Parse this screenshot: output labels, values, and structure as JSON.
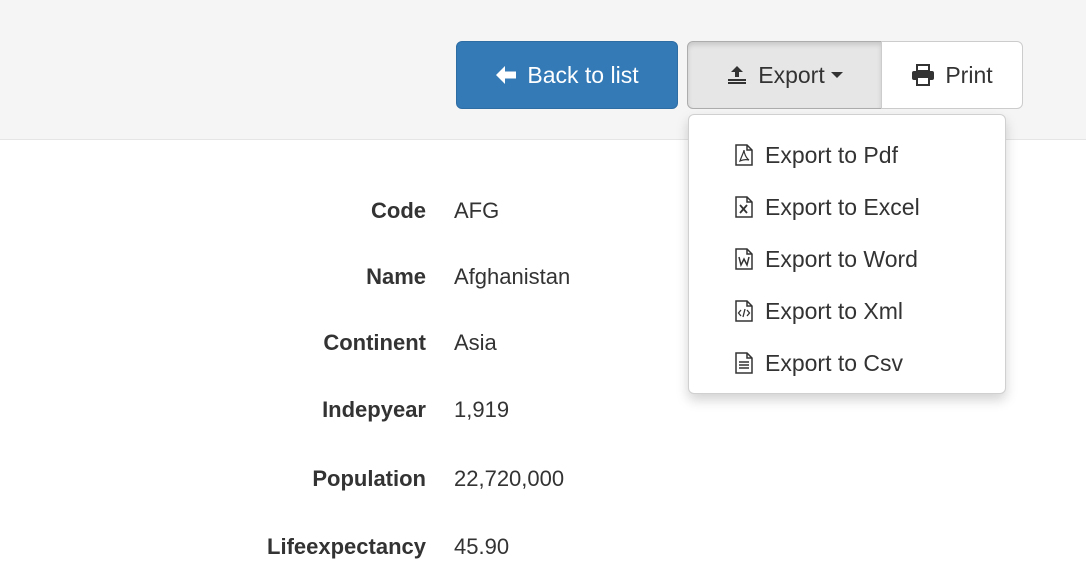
{
  "toolbar": {
    "back_label": "Back to list",
    "export_label": "Export",
    "print_label": "Print",
    "back_color": "#337ab7"
  },
  "export_menu": {
    "items": [
      {
        "label": "Export to Pdf",
        "icon": "pdf-file-icon"
      },
      {
        "label": "Export to Excel",
        "icon": "excel-file-icon"
      },
      {
        "label": "Export to Word",
        "icon": "word-file-icon"
      },
      {
        "label": "Export to Xml",
        "icon": "xml-file-icon"
      },
      {
        "label": "Export to Csv",
        "icon": "csv-file-icon"
      }
    ]
  },
  "record": {
    "fields": [
      {
        "label": "Code",
        "value": "AFG"
      },
      {
        "label": "Name",
        "value": "Afghanistan"
      },
      {
        "label": "Continent",
        "value": "Asia"
      },
      {
        "label": "Indepyear",
        "value": "1,919"
      },
      {
        "label": "Population",
        "value": "22,720,000"
      },
      {
        "label": "Lifeexpectancy",
        "value": "45.90"
      }
    ]
  }
}
